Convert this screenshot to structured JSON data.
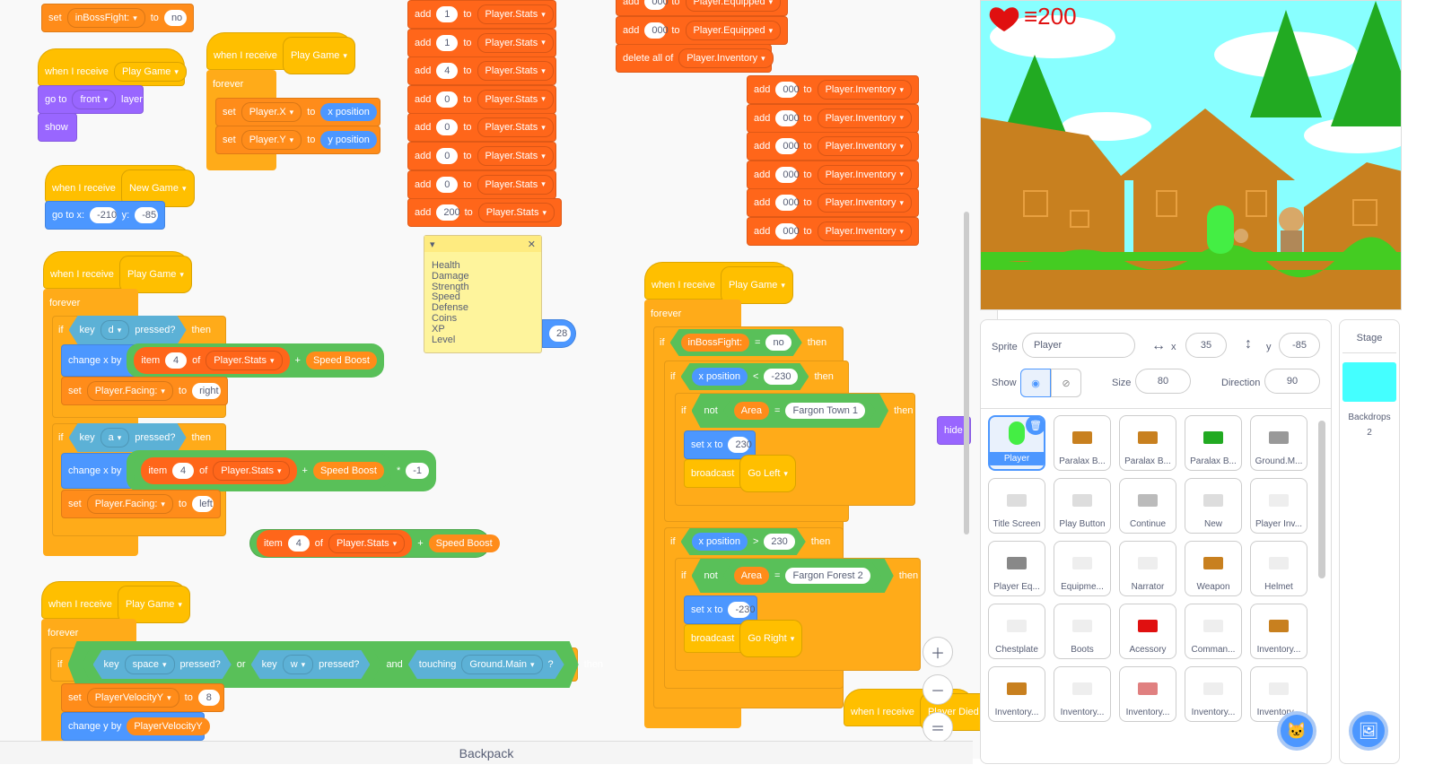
{
  "stage": {
    "hearts_text": "≡200"
  },
  "comment_text": "Health\nDamage\nStrength\nSpeed\nDefense\nCoins\nXP\nLevel",
  "backpack_label": "Backpack",
  "reporter_28": "28",
  "hide_label": "hide",
  "blocks": {
    "set": "set",
    "to": "to",
    "when_receive": "when I receive",
    "forever": "forever",
    "if": "if",
    "then": "then",
    "go_to": "go to",
    "layer": "layer",
    "show": "show",
    "go_to_x": "go to x:",
    "y": "y:",
    "key": "key",
    "pressed": "pressed?",
    "change_x_by": "change x by",
    "item": "item",
    "of": "of",
    "add": "add",
    "delete_all_of": "delete all of",
    "not": "not",
    "set_x_to": "set x to",
    "broadcast": "broadcast",
    "change_y_by": "change y by",
    "or": "or",
    "and": "and",
    "touching": "touching",
    "q": "?",
    "eq": "=",
    "lt": "<",
    "gt": ">",
    "plus": "+",
    "times": "*",
    "inBossFight": "inBossFight:",
    "no": "no",
    "play_game": "Play Game",
    "front": "front",
    "new_game": "New Game",
    "player_x": "Player.X",
    "player_y": "Player.Y",
    "x_position": "x position",
    "y_position": "y position",
    "neg210": "-210",
    "neg85": "-85",
    "d": "d",
    "a": "a",
    "four": "4",
    "player_stats": "Player.Stats",
    "speed_boost": "Speed Boost",
    "player_facing": "Player.Facing:",
    "right": "right",
    "left": "left",
    "neg1": "-1",
    "space": "space",
    "w": "w",
    "ground_main": "Ground.Main",
    "velY": "PlayerVelocityY",
    "eight": "8",
    "stats_vals": [
      "1",
      "1",
      "4",
      "0",
      "0",
      "0",
      "0",
      "200"
    ],
    "zero3": "000",
    "player_equipped": "Player.Equipped",
    "player_inventory": "Player.Inventory",
    "inBossFightVar": "inBossFight",
    "neg230": "-230",
    "area": "Area",
    "fargon_town": "Fargon Town 1",
    "twothirty": "230",
    "go_left": "Go Left",
    "fargon_forest": "Fargon Forest 2",
    "go_right": "Go Right",
    "player_died": "Player Died"
  },
  "sprite_info": {
    "sprite_label": "Sprite",
    "sprite_name": "Player",
    "x_label": "x",
    "x_val": "35",
    "y_label": "y",
    "y_val": "-85",
    "show_label": "Show",
    "size_label": "Size",
    "size_val": "80",
    "direction_label": "Direction",
    "direction_val": "90"
  },
  "sprites": [
    "Player",
    "Paralax B...",
    "Paralax B...",
    "Paralax B...",
    "Ground.M...",
    "Title Screen",
    "Play Button",
    "Continue",
    "New",
    "Player Inv...",
    "Player Eq...",
    "Equipme...",
    "Narrator",
    "Weapon",
    "Helmet",
    "Chestplate",
    "Boots",
    "Acessory",
    "Comman...",
    "Inventory...",
    "Inventory...",
    "Inventory...",
    "Inventory...",
    "Inventory...",
    "Inventory..."
  ],
  "stage_panel": {
    "title": "Stage",
    "backdrops_label": "Backdrops",
    "backdrops_count": "2"
  },
  "colors": {
    "events": "#ffbf00",
    "control": "#ffab19",
    "variables": "#ff8c1a",
    "lists": "#ff661a",
    "motion": "#4c97ff",
    "looks": "#9966ff",
    "sensing": "#5cb1d6",
    "operators": "#59c059"
  }
}
